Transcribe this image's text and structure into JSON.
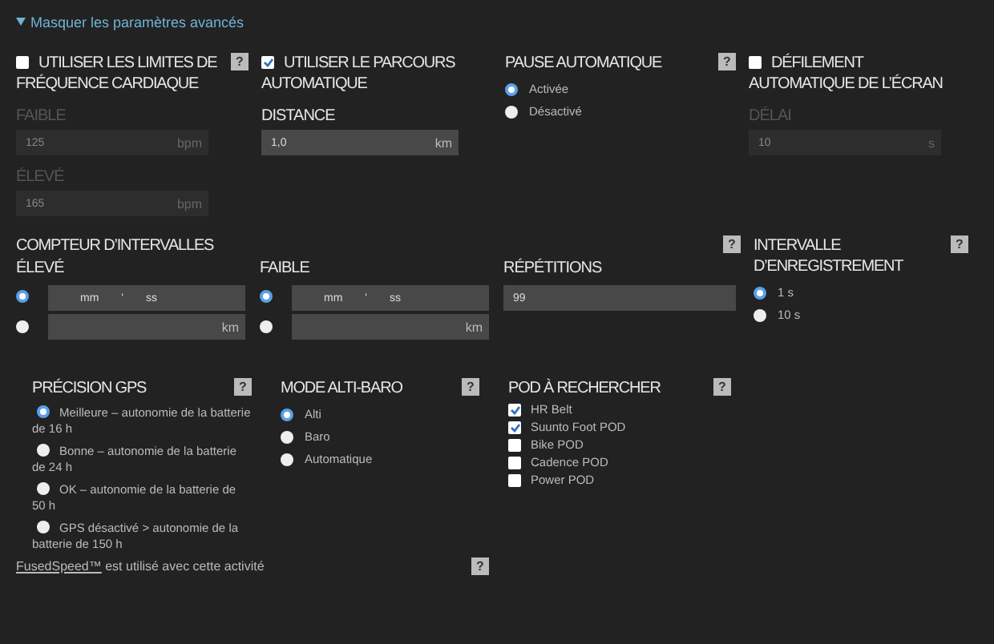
{
  "toggle": {
    "label": "Masquer les paramètres avancés",
    "expanded": true
  },
  "heart_rate_limits": {
    "title": "UTILISER LES LIMITES DE FRÉQUENCE CARDIAQUE",
    "checked": false,
    "help": "?",
    "fields": [
      {
        "label": "FAIBLE",
        "value": "125",
        "unit": "bpm"
      },
      {
        "label": "ÉLEVÉ",
        "value": "165",
        "unit": "bpm"
      }
    ]
  },
  "auto_lap": {
    "title": "UTILISER LE PARCOURS AUTOMATIQUE",
    "checked": true,
    "fields": [
      {
        "label": "DISTANCE",
        "value": "1,0",
        "unit": "km"
      }
    ]
  },
  "auto_pause": {
    "title": "PAUSE AUTOMATIQUE",
    "help": "?",
    "options": [
      {
        "label": "Activée",
        "selected": true
      },
      {
        "label": "Désactivé",
        "selected": false
      }
    ]
  },
  "auto_scroll": {
    "title": "DÉFILEMENT AUTOMATIQUE DE L’ÉCRAN",
    "checked": false,
    "fields": [
      {
        "label": "DÉLAI",
        "value": "10",
        "unit": "s"
      }
    ]
  },
  "interval_timer": {
    "title": "COMPTEUR D’INTERVALLES",
    "help": "?",
    "groups": [
      {
        "label": "ÉLEVÉ",
        "time": {
          "selected": true,
          "minutes": "mm",
          "separator": "'",
          "seconds": "ss"
        },
        "distance": {
          "selected": false,
          "unit": "km"
        }
      },
      {
        "label": "FAIBLE",
        "time": {
          "selected": true,
          "minutes": "mm",
          "separator": "'",
          "seconds": "ss"
        },
        "distance": {
          "selected": false,
          "unit": "km"
        }
      }
    ],
    "repetitions": {
      "label": "RÉPÉTITIONS",
      "value": "99"
    }
  },
  "recording_interval": {
    "title": "INTERVALLE D’ENREGISTREMENT",
    "help": "?",
    "options": [
      {
        "label": "1 s",
        "selected": true
      },
      {
        "label": "10 s",
        "selected": false
      }
    ]
  },
  "gps_accuracy": {
    "title": "PRÉCISION GPS",
    "help": "?",
    "options": [
      {
        "label": "Meilleure – autonomie de la batterie de 16 h",
        "selected": true
      },
      {
        "label": "Bonne – autonomie de la batterie de 24 h",
        "selected": false
      },
      {
        "label": "OK – autonomie de la batterie de 50 h",
        "selected": false
      },
      {
        "label": "GPS désactivé > autonomie de la batterie de 150 h",
        "selected": false
      }
    ]
  },
  "altibaro": {
    "title": "MODE ALTI-BARO",
    "help": "?",
    "options": [
      {
        "label": "Alti",
        "selected": true
      },
      {
        "label": "Baro",
        "selected": false
      },
      {
        "label": "Automatique",
        "selected": false
      }
    ]
  },
  "pods": {
    "title": "POD À RECHERCHER",
    "help": "?",
    "items": [
      {
        "label": "HR Belt",
        "checked": true
      },
      {
        "label": "Suunto Foot POD",
        "checked": true
      },
      {
        "label": "Bike POD",
        "checked": false
      },
      {
        "label": "Cadence POD",
        "checked": false
      },
      {
        "label": "Power POD",
        "checked": false
      }
    ]
  },
  "footer": {
    "link": "FusedSpeed™",
    "text": "est utilisé avec cette activité",
    "help": "?"
  }
}
